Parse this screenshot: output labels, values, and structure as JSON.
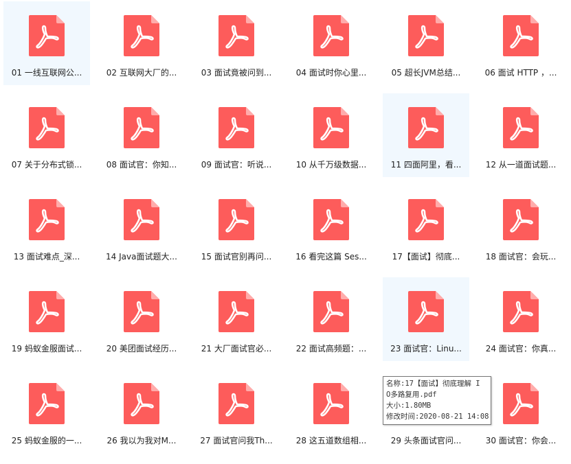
{
  "window": {
    "background": "#ffffff"
  },
  "colors": {
    "pdf_icon": "#fd5c5b",
    "pdf_fold": "#ffacab",
    "highlight_bg": "#f1f8fe"
  },
  "files": [
    {
      "label": "01 一线互联网公...",
      "icon": "pdf-file-icon",
      "state": "selected"
    },
    {
      "label": "02 互联网大厂的...",
      "icon": "pdf-file-icon"
    },
    {
      "label": "03 面试竟被问到...",
      "icon": "pdf-file-icon"
    },
    {
      "label": "04 面试时你心里...",
      "icon": "pdf-file-icon"
    },
    {
      "label": "05 超长JVM总结...",
      "icon": "pdf-file-icon"
    },
    {
      "label": "06 面试 HTTP ，...",
      "icon": "pdf-file-icon"
    },
    {
      "label": "07 关于分布式锁...",
      "icon": "pdf-file-icon"
    },
    {
      "label": "08 面试官：你知...",
      "icon": "pdf-file-icon"
    },
    {
      "label": "09 面试官：听说...",
      "icon": "pdf-file-icon"
    },
    {
      "label": "10 从千万级数据...",
      "icon": "pdf-file-icon"
    },
    {
      "label": "11 四面阿里，看...",
      "icon": "pdf-file-icon",
      "state": "hover"
    },
    {
      "label": "12 从一道面试题...",
      "icon": "pdf-file-icon"
    },
    {
      "label": "13 面试难点_深...",
      "icon": "pdf-file-icon"
    },
    {
      "label": "14 Java面试题大...",
      "icon": "pdf-file-icon"
    },
    {
      "label": "15 面试官别再问...",
      "icon": "pdf-file-icon"
    },
    {
      "label": "16 看完这篇 Ses...",
      "icon": "pdf-file-icon"
    },
    {
      "label": "17【面试】彻底...",
      "icon": "pdf-file-icon"
    },
    {
      "label": "18 面试官：会玩...",
      "icon": "pdf-file-icon"
    },
    {
      "label": "19 蚂蚁金服面试...",
      "icon": "pdf-file-icon"
    },
    {
      "label": "20 美团面试经历...",
      "icon": "pdf-file-icon"
    },
    {
      "label": "21 大厂面试官必...",
      "icon": "pdf-file-icon"
    },
    {
      "label": "22 面试高频题：...",
      "icon": "pdf-file-icon"
    },
    {
      "label": "23 面试官：Linu...",
      "icon": "pdf-file-icon",
      "state": "hover"
    },
    {
      "label": "24 面试官：你真...",
      "icon": "pdf-file-icon"
    },
    {
      "label": "25 蚂蚁金服的一...",
      "icon": "pdf-file-icon"
    },
    {
      "label": "26 我以为我对M...",
      "icon": "pdf-file-icon"
    },
    {
      "label": "27 面试官问我Th...",
      "icon": "pdf-file-icon"
    },
    {
      "label": "28 这五道数组相...",
      "icon": "pdf-file-icon"
    },
    {
      "label": "29 头条面试官问...",
      "icon": "pdf-file-icon"
    },
    {
      "label": "30 面试官：你会...",
      "icon": "pdf-file-icon"
    }
  ],
  "tooltip": {
    "line1": "名称:17【面试】彻底理解 I",
    "line2": "O多路复用.pdf",
    "line3": "大小:1.80MB",
    "line4": "修改时间:2020-08-21 14:08"
  }
}
